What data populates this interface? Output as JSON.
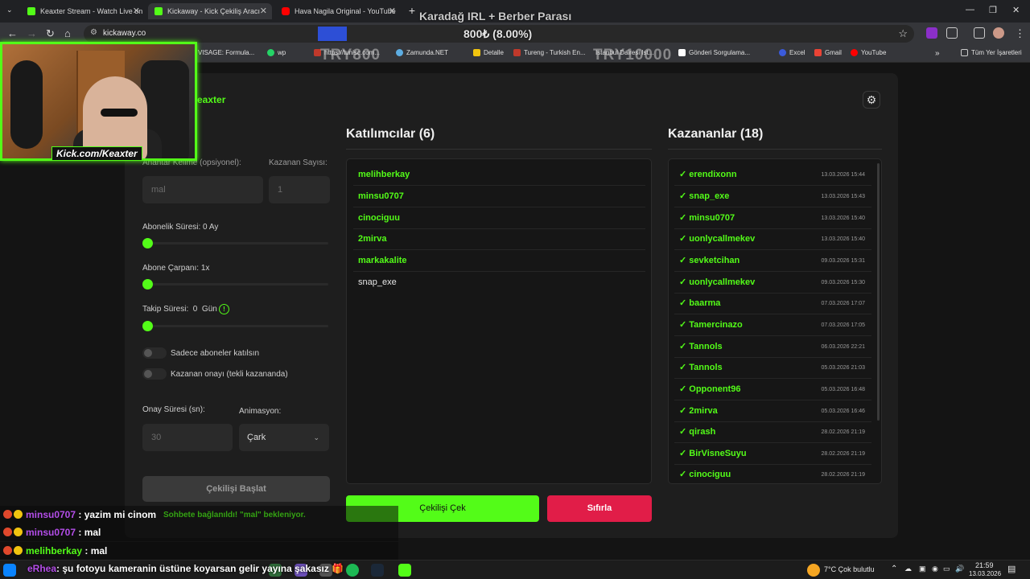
{
  "browser": {
    "tabs": [
      {
        "title": "Keaxter Stream - Watch Live on",
        "active": false
      },
      {
        "title": "Kickaway - Kick Çekiliş Aracı",
        "active": true
      },
      {
        "title": "Hava Nagila Original - YouTube",
        "active": false
      }
    ],
    "url": "kickaway.co",
    "bookmarks": [
      "VISAGE: Formula...",
      "wp",
      "https://tunisc.com...",
      "Zamunda.NET",
      "Detalle",
      "Tureng - Turkish En...",
      "Istanbul Dairesi Ist...",
      "Gönderi Sorgulama...",
      "Excel",
      "Gmail",
      "YouTube"
    ],
    "all_bookmarks": "Tüm Yer İşaretleri"
  },
  "overlay": {
    "title": "Karadağ IRL + Berber Parası",
    "progress": "800₺ (8.00%)",
    "goal_left": "TRY800",
    "goal_right": "TRY10000",
    "cam_label": "Kick.com/Keaxter"
  },
  "app": {
    "brand": "eaxter",
    "form": {
      "keyword_label": "Anahtar Kelime (opsiyonel):",
      "keyword_value": "mal",
      "winner_count_label": "Kazanan Sayısı:",
      "winner_count_value": "1",
      "subscription_label": "Abonelik Süresi: 0 Ay",
      "multiplier_label": "Abone Çarpanı: 1x",
      "follow_label": "Takip Süresi:  0  Gün",
      "follow_info": "!",
      "subs_only_label": "Sadece aboneler katılsın",
      "winner_confirm_label": "Kazanan onayı (tekli kazananda)",
      "confirm_time_label": "Onay Süresi (sn):",
      "confirm_time_value": "30",
      "animation_label": "Animasyon:",
      "animation_value": "Çark",
      "start_button": "Çekilişi Başlat"
    },
    "participants": {
      "title": "Katılımcılar (6)",
      "items": [
        {
          "name": "melihberkay",
          "color": "#53fc18"
        },
        {
          "name": "minsu0707",
          "color": "#53fc18"
        },
        {
          "name": "cinociguu",
          "color": "#53fc18"
        },
        {
          "name": "2mirva",
          "color": "#53fc18"
        },
        {
          "name": "markakalite",
          "color": "#53fc18"
        },
        {
          "name": "snap_exe",
          "color": "#e6e6e6"
        }
      ]
    },
    "winners": {
      "title": "Kazananlar (18)",
      "items": [
        {
          "name": "✓ erendixonn",
          "date": "13.03.2026 15:44"
        },
        {
          "name": "✓ snap_exe",
          "date": "13.03.2026 15:43"
        },
        {
          "name": "✓ minsu0707",
          "date": "13.03.2026 15:40"
        },
        {
          "name": "✓ uonlycallmekev",
          "date": "13.03.2026 15:40"
        },
        {
          "name": "✓ sevketcihan",
          "date": "09.03.2026 15:31"
        },
        {
          "name": "✓ uonlycallmekev",
          "date": "09.03.2026 15:30"
        },
        {
          "name": "✓ baarma",
          "date": "07.03.2026 17:07"
        },
        {
          "name": "✓ Tamercinazo",
          "date": "07.03.2026 17:05"
        },
        {
          "name": "✓ Tannols",
          "date": "06.03.2026 22:21"
        },
        {
          "name": "✓ Tannols",
          "date": "05.03.2026 21:03"
        },
        {
          "name": "✓ Opponent96",
          "date": "05.03.2026 16:48"
        },
        {
          "name": "✓ 2mirva",
          "date": "05.03.2026 16:46"
        },
        {
          "name": "✓ qirash",
          "date": "28.02.2026 21:19"
        },
        {
          "name": "✓ BirVisneSuyu",
          "date": "28.02.2026 21:19"
        },
        {
          "name": "✓ cinociguu",
          "date": "28.02.2026 21:19"
        }
      ]
    },
    "draw_button": "Çekilişi Çek",
    "reset_button": "Sıfırla",
    "status": "Sohbete bağlanıldı! \"mal\" bekleniyor."
  },
  "chat": [
    {
      "user": "minsu0707",
      "msg": " : yazim mi cinom",
      "user_color": "#b34de8"
    },
    {
      "user": "minsu0707",
      "msg": " : mal",
      "user_color": "#b34de8"
    },
    {
      "user": "melihberkay",
      "msg": " : mal",
      "user_color": "#53fc18"
    }
  ],
  "ticker": {
    "user": "eRhea",
    "msg": ": şu fotoyu kameranin üstüne koyarsan gelir yayına şakasız 🎁"
  },
  "taskbar": {
    "weather": "7°C  Çok bulutlu",
    "time": "21:59",
    "date": "13.03.2026"
  }
}
